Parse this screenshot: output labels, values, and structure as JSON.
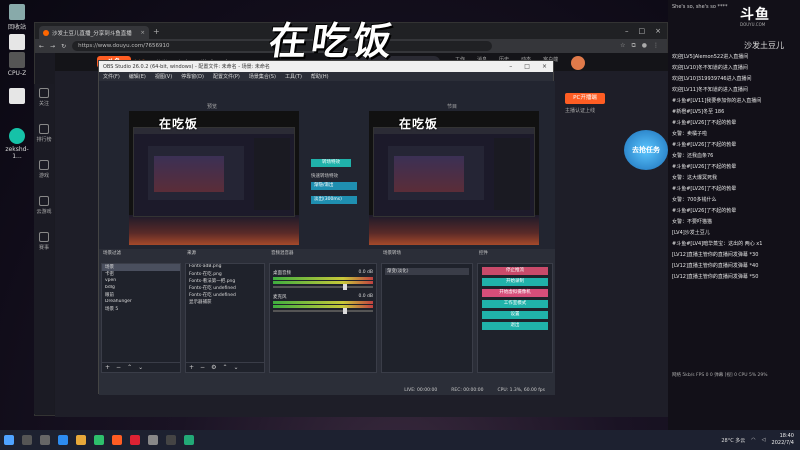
{
  "desktop": {
    "icons": [
      {
        "label": "回收站"
      },
      {
        "label": ""
      },
      {
        "label": "CPU-Z"
      },
      {
        "label": ""
      },
      {
        "label": "zekshd-1..."
      }
    ]
  },
  "overlay": {
    "text": "在吃饭"
  },
  "browser": {
    "tab_title": "沙发土豆儿直播_分享到斗鱼直播",
    "url": "https://www.douyu.com/7656910"
  },
  "douyu": {
    "logo": "斗鱼",
    "nav": [
      "首页",
      "直播",
      "分类",
      "视频",
      "游戏",
      "鱼吧"
    ],
    "left_nav": [
      "关注",
      "排行榜",
      "游戏",
      "云游戏",
      "赛事"
    ],
    "header_icons": [
      "工作",
      "消息",
      "历史",
      "动态",
      "客户端"
    ],
    "streamer_number": "12",
    "pc_button": "PC开播端",
    "pc_sub": "主播认证上线"
  },
  "obs": {
    "title": "OBS Studio 26.0.2 (64-bit, windows) - 配置文件: 未命名 - 场景: 未命名",
    "menu": [
      "文件(F)",
      "编辑(E)",
      "视图(V)",
      "停靠窗(D)",
      "配置文件(P)",
      "场景集合(S)",
      "工具(T)",
      "帮助(H)"
    ],
    "preview_label": "预览",
    "program_label": "节目",
    "transition": {
      "btn": "转场特效",
      "label": "快速转场特效",
      "opt1": "渐隐/渐出",
      "opt2": "淡出(300ms)"
    },
    "warning": "准备开始节目成功",
    "dock_titles": {
      "scenes": "场景过滤",
      "sources": "来源",
      "mixer": "音频混音器",
      "transitions": "场景转场",
      "controls": "控件"
    },
    "scenes": [
      "场景",
      "卡密",
      "vpen",
      "bdlg",
      "眼前",
      "Dreahunger",
      "场景 5"
    ],
    "sources": [
      "Fonts-adB.png",
      "Fonts-在吃.png",
      "Fonts-看法第一把.png",
      "Fonts-在吃 undefined",
      "Fonts-在吃 undefined",
      "显示器捕获"
    ],
    "mixer": [
      {
        "name": "桌面音频",
        "db": "0.0 dB"
      },
      {
        "name": "麦克风",
        "db": "0.0 dB"
      }
    ],
    "trans_select": "渐变(淡化)",
    "controls": [
      "停止推流",
      "开始录制",
      "开始虚拟摄像机",
      "工作室模式",
      "设置",
      "退出"
    ],
    "status": [
      "LIVE: 00:00:00",
      "REC: 00:00:00",
      "CPU: 1.3%, 60.00 fps"
    ]
  },
  "chat": {
    "stamp": "She's so, she's so ****",
    "logo": "斗鱼",
    "logo_sub": "DOUYU.COM",
    "streamer": "沙发土豆儿",
    "messages": [
      {
        "text": "欢迎[LV5]Alemon522进入直播间"
      },
      {
        "text": "欢迎[LV10]冬不知道的进入直播间"
      },
      {
        "text": "欢迎[LV10]319939746进入直播间"
      },
      {
        "text": "欢迎[LV11]冬不知道的进入直播间"
      },
      {
        "text": "#斗鱼#[LV11]我要参加你的进入直播间"
      },
      {
        "text": "#新橙#[LV5]冬至 186"
      },
      {
        "text": "#斗鱼#[LV26]了不起的勃晕"
      },
      {
        "text": "女警：卖橘子啦"
      },
      {
        "text": "#斗鱼#[LV26]了不起的勃晕"
      },
      {
        "text": "女警：还我血条76"
      },
      {
        "text": "#斗鱼#[LV26]了不起的勃晕"
      },
      {
        "text": "女警：这大爆冥死我"
      },
      {
        "text": "#斗鱼#[LV26]了不起的勃晕"
      },
      {
        "text": "女警：700多钱什么"
      },
      {
        "text": "#斗鱼#[LV26]了不起的勃晕"
      },
      {
        "text": "女警：不要吓猫猫"
      },
      {
        "text": "[LV4]沙发土豆儿"
      },
      {
        "text": "#斗鱼#[LV4]暗华蒸宝：这出的 两心 x1"
      },
      {
        "text": "[LV12]直播主管你的直播间发弹幕 *30"
      },
      {
        "text": "[LV12]直播主管你的直播间发弹幕 *40"
      },
      {
        "text": "[LV12]直播主管你的直播间发弹幕 *50"
      }
    ],
    "footer": "网络 5kb/s  FPS 0  0 弹幕 [视] 0  CPU 5%  29%"
  },
  "gift": {
    "text": "去抢任务"
  },
  "taskbar": {
    "weather": "28°C 多云",
    "time": "18:40",
    "date": "2022/7/4"
  }
}
